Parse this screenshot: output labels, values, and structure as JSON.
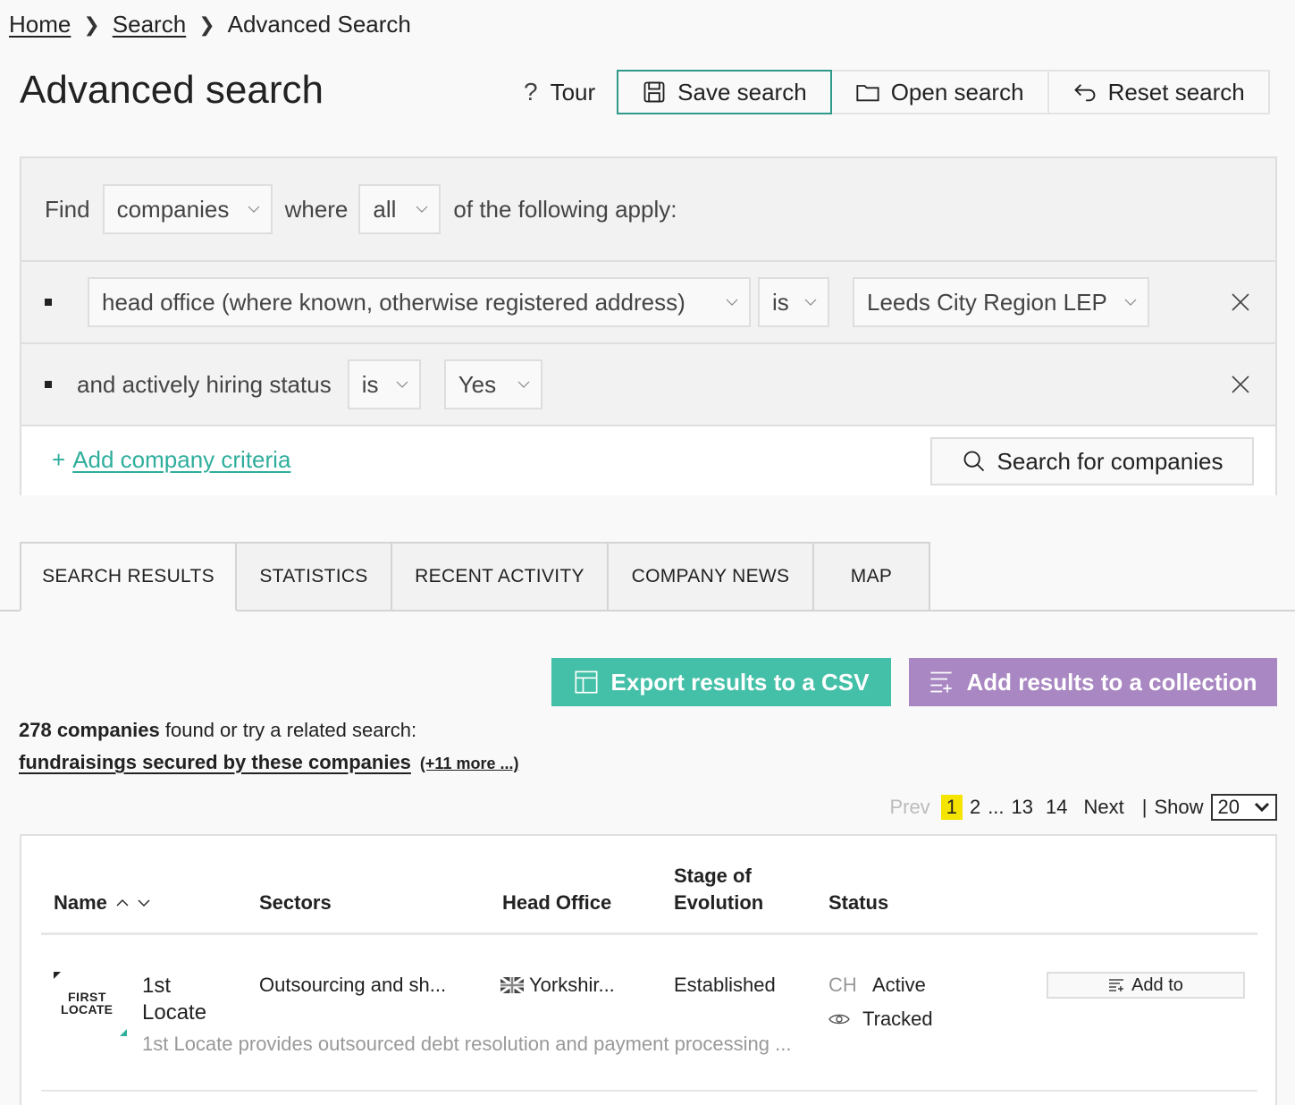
{
  "breadcrumb": {
    "home": "Home",
    "search": "Search",
    "current": "Advanced Search"
  },
  "page": {
    "title": "Advanced search"
  },
  "toolbar": {
    "tour": "Tour",
    "save": "Save search",
    "open": "Open search",
    "reset": "Reset search"
  },
  "criteria": {
    "find_label": "Find",
    "entity": "companies",
    "where_label": "where",
    "match": "all",
    "apply_label": "of the following apply:",
    "row1": {
      "field": "head office (where known, otherwise registered address)",
      "op": "is",
      "value": "Leeds City Region LEP"
    },
    "row2": {
      "field": "and actively hiring status",
      "op": "is",
      "value": "Yes"
    },
    "add_label": "Add company criteria",
    "add_plus": "+",
    "search_button": "Search for companies"
  },
  "tabs": [
    "SEARCH RESULTS",
    "STATISTICS",
    "RECENT ACTIVITY",
    "COMPANY NEWS",
    "MAP"
  ],
  "actions": {
    "csv": "Export results to a CSV",
    "collection": "Add results to a collection"
  },
  "results": {
    "count": "278 companies",
    "found_text": "found or try a related search:",
    "related_link": "fundraisings secured by these companies",
    "related_more": "(+11 more ...)"
  },
  "pager": {
    "prev": "Prev",
    "current": "1",
    "p2": "2",
    "ellipsis": "...",
    "p13": "13",
    "p14": "14",
    "next": "Next",
    "sep": "|",
    "show_label": "Show",
    "show_value": "20"
  },
  "table": {
    "headers": {
      "name": "Name",
      "sectors": "Sectors",
      "head_office": "Head Office",
      "stage_1": "Stage of",
      "stage_2": "Evolution",
      "status": "Status"
    },
    "rows": [
      {
        "logo_text_1": "FIRST",
        "logo_text_2": "LOCATE",
        "name_1": "1st",
        "name_2": "Locate",
        "sectors": "Outsourcing and sh...",
        "head_office": "Yorkshir...",
        "stage": "Established",
        "status_code": "CH",
        "status": "Active",
        "tracked": "Tracked",
        "description": "1st Locate provides outsourced debt resolution and payment processing ...",
        "add_to": "Add to"
      }
    ]
  },
  "colors": {
    "teal": "#45c0a8",
    "purple": "#a987c2",
    "highlight": "#f4e400",
    "link_teal": "#2fae9c"
  }
}
